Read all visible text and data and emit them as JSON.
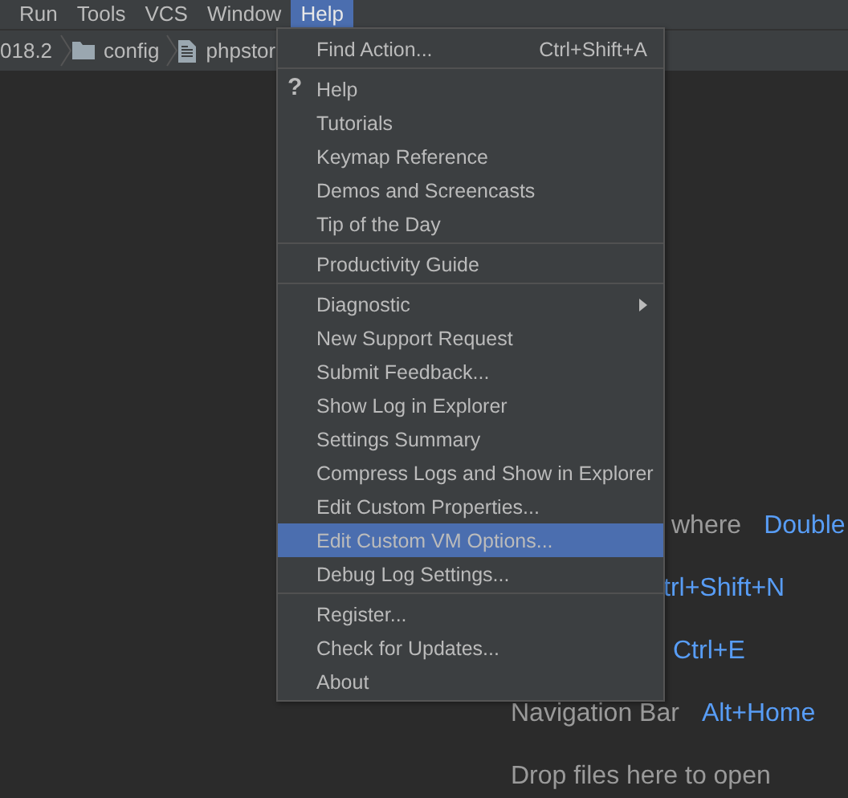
{
  "menubar": [
    {
      "label": "Run",
      "selected": false
    },
    {
      "label": "Tools",
      "selected": false
    },
    {
      "label": "VCS",
      "selected": false
    },
    {
      "label": "Window",
      "selected": false
    },
    {
      "label": "Help",
      "selected": true
    }
  ],
  "breadcrumbs": [
    {
      "kind": "text",
      "label": "018.2"
    },
    {
      "kind": "folder",
      "label": "config"
    },
    {
      "kind": "file",
      "label": "phpstor"
    }
  ],
  "menu": {
    "groups": [
      [
        {
          "label": "Find Action...",
          "shortcut": "Ctrl+Shift+A",
          "selected": false,
          "submenu": false
        }
      ],
      [
        {
          "label": "Help",
          "icon": "?",
          "selected": false,
          "submenu": false
        },
        {
          "label": "Tutorials",
          "selected": false,
          "submenu": false
        },
        {
          "label": "Keymap Reference",
          "selected": false,
          "submenu": false
        },
        {
          "label": "Demos and Screencasts",
          "selected": false,
          "submenu": false
        },
        {
          "label": "Tip of the Day",
          "selected": false,
          "submenu": false
        }
      ],
      [
        {
          "label": "Productivity Guide",
          "selected": false,
          "submenu": false
        }
      ],
      [
        {
          "label": "Diagnostic",
          "selected": false,
          "submenu": true
        },
        {
          "label": "New Support Request",
          "selected": false,
          "submenu": false
        },
        {
          "label": "Submit Feedback...",
          "selected": false,
          "submenu": false
        },
        {
          "label": "Show Log in Explorer",
          "selected": false,
          "submenu": false
        },
        {
          "label": "Settings Summary",
          "selected": false,
          "submenu": false
        },
        {
          "label": "Compress Logs and Show in Explorer",
          "selected": false,
          "submenu": false
        },
        {
          "label": "Edit Custom Properties...",
          "selected": false,
          "submenu": false
        },
        {
          "label": "Edit Custom VM Options...",
          "selected": true,
          "submenu": false
        },
        {
          "label": "Debug Log Settings...",
          "selected": false,
          "submenu": false
        }
      ],
      [
        {
          "label": "Register...",
          "selected": false,
          "submenu": false
        },
        {
          "label": "Check for Updates...",
          "selected": false,
          "submenu": false
        },
        {
          "label": "About",
          "selected": false,
          "submenu": false
        }
      ]
    ]
  },
  "editor_hints": [
    {
      "kind": "partial",
      "label": "where",
      "shortcut": "Double"
    },
    {
      "kind": "covered",
      "shortcut": "trl+Shift+N"
    },
    {
      "kind": "covered",
      "shortcut": "Ctrl+E"
    },
    {
      "kind": "full",
      "label": "Navigation Bar",
      "shortcut": "Alt+Home"
    },
    {
      "kind": "full",
      "label": "Drop files here to open"
    }
  ]
}
